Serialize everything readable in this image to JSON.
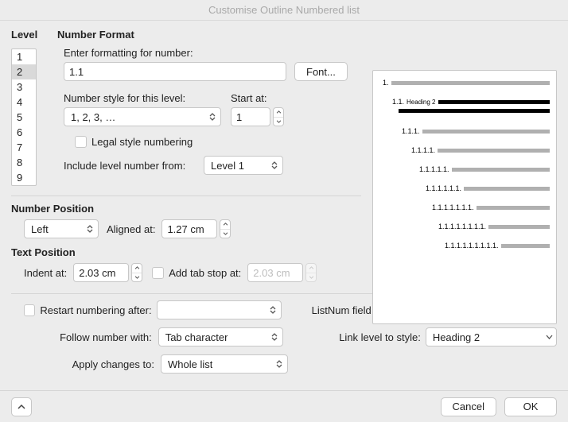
{
  "title": "Customise Outline Numbered list",
  "headings": {
    "level": "Level",
    "number_format": "Number Format",
    "number_position": "Number Position",
    "text_position": "Text Position"
  },
  "levels": [
    "1",
    "2",
    "3",
    "4",
    "5",
    "6",
    "7",
    "8",
    "9"
  ],
  "selected_level_index": 1,
  "number_format": {
    "enter_formatting_label": "Enter formatting for number:",
    "enter_formatting_value": "1.1",
    "font_button": "Font...",
    "style_label": "Number style for this level:",
    "style_value": "1, 2, 3, …",
    "start_at_label": "Start at:",
    "start_at_value": "1",
    "legal_style_label": "Legal style numbering",
    "include_level_label": "Include level number from:",
    "include_level_value": "Level 1"
  },
  "number_position": {
    "alignment_value": "Left",
    "aligned_at_label": "Aligned at:",
    "aligned_at_value": "1.27 cm"
  },
  "text_position": {
    "indent_at_label": "Indent at:",
    "indent_at_value": "2.03 cm",
    "add_tab_label": "Add tab stop at:",
    "add_tab_value": "2.03 cm"
  },
  "options": {
    "restart_label": "Restart numbering after:",
    "restart_value": "",
    "follow_label": "Follow number with:",
    "follow_value": "Tab character",
    "apply_label": "Apply changes to:",
    "apply_value": "Whole list",
    "listnum_label": "ListNum field list name:",
    "listnum_value": "",
    "link_label": "Link level to style:",
    "link_value": "Heading 2"
  },
  "preview": {
    "heading2_label": "Heading 2",
    "levels": [
      "1.",
      "1.1.",
      "1.1.1.",
      "1.1.1.1.",
      "1.1.1.1.1.",
      "1.1.1.1.1.1.",
      "1.1.1.1.1.1.1.",
      "1.1.1.1.1.1.1.1.",
      "1.1.1.1.1.1.1.1.1."
    ]
  },
  "buttons": {
    "cancel": "Cancel",
    "ok": "OK"
  }
}
